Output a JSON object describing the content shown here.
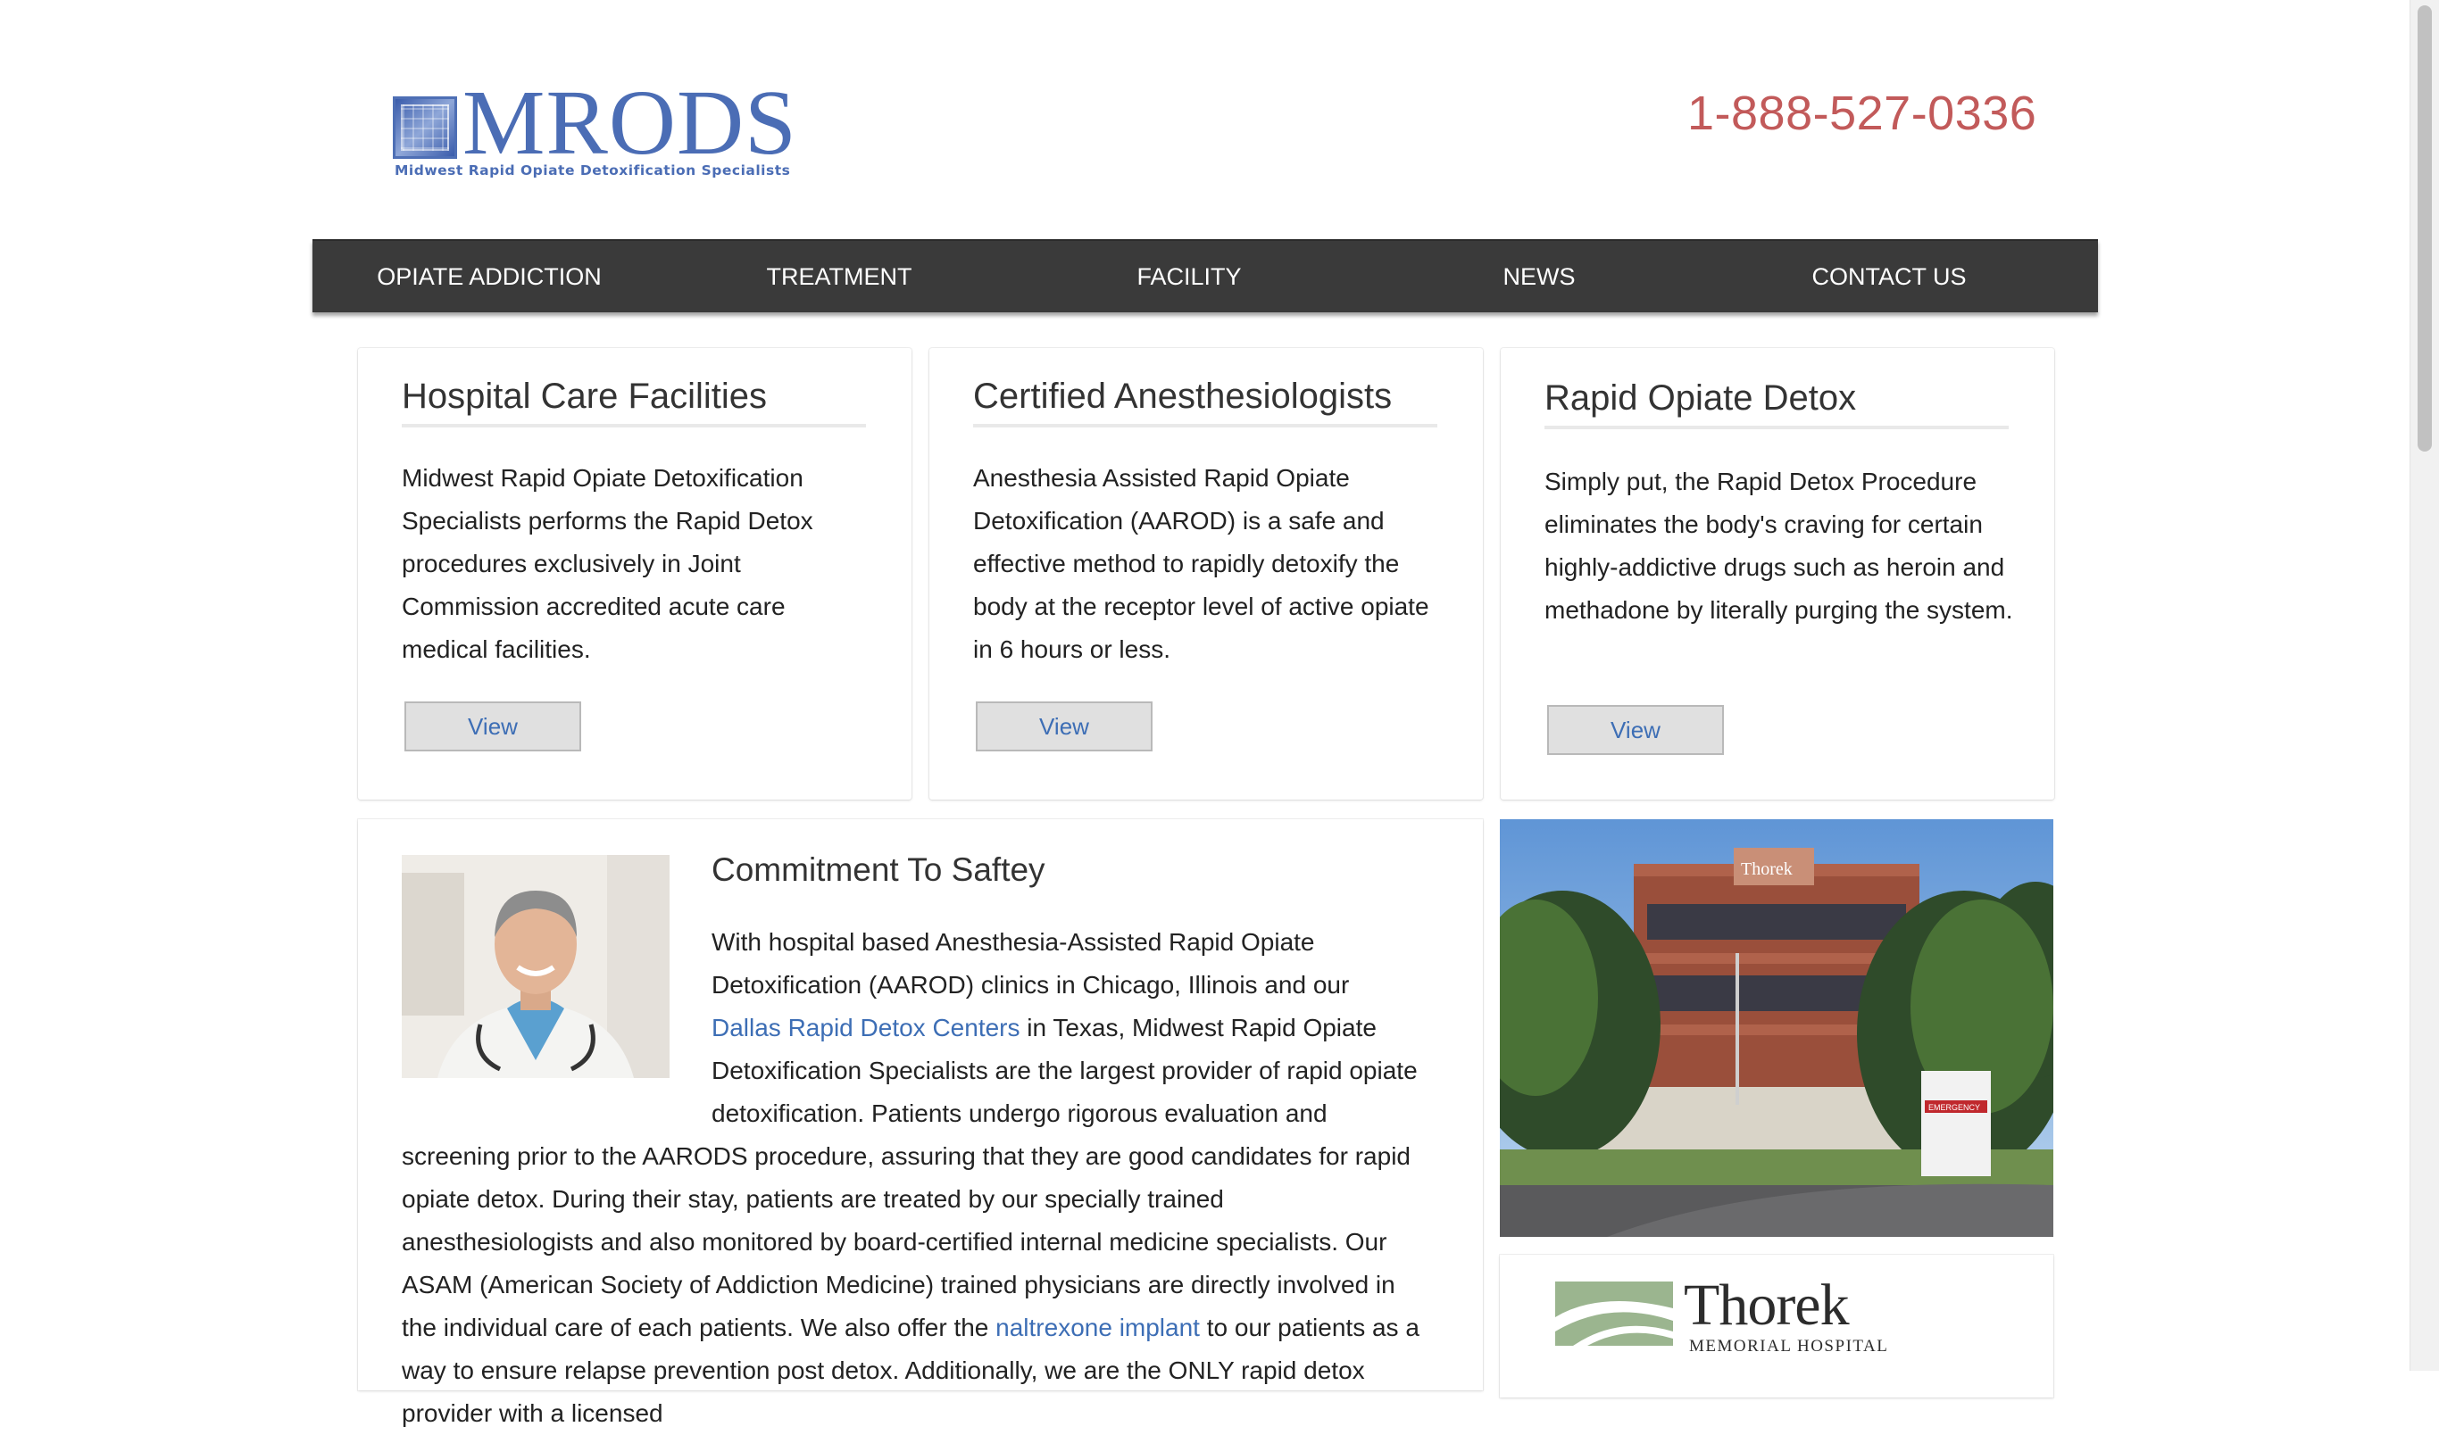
{
  "header": {
    "logo_text": "MRODS",
    "logo_tagline": "Midwest Rapid Opiate Detoxification Specialists",
    "phone": "1-888-527-0336"
  },
  "nav": {
    "items": [
      {
        "label": "OPIATE ADDICTION"
      },
      {
        "label": "TREATMENT"
      },
      {
        "label": "FACILITY"
      },
      {
        "label": "NEWS"
      },
      {
        "label": "CONTACT US"
      }
    ]
  },
  "cards": [
    {
      "title": "Hospital Care Facilities",
      "text": "Midwest Rapid Opiate Detoxification Specialists performs the Rapid Detox procedures exclusively in Joint Commission accredited acute care medical facilities.",
      "button": "View"
    },
    {
      "title": "Certified Anesthesiologists",
      "text": "Anesthesia Assisted Rapid Opiate Detoxification (AAROD) is a safe and effective method to rapidly detoxify the body at the receptor level of active opiate in 6 hours or less.",
      "button": "View"
    },
    {
      "title": "Rapid Opiate Detox",
      "text": "Simply put, the Rapid Detox Procedure eliminates the body's craving for certain highly-addictive drugs such as heroin and methadone by literally purging the system.",
      "button": "View"
    }
  ],
  "commitment": {
    "title": "Commitment To Saftey",
    "text_1": "With hospital based Anesthesia-Assisted Rapid Opiate Detoxification (AAROD) clinics in Chicago, Illinois and our ",
    "link_1": "Dallas Rapid Detox Centers",
    "text_2": " in Texas, Midwest Rapid Opiate Detoxification Specialists are the largest provider of rapid opiate detoxification. Patients undergo rigorous evaluation and screening prior to the AARODS procedure, assuring that they are good candidates for rapid opiate detox. During their stay, patients are treated by our specially trained anesthesiologists and also monitored by board-certified internal medicine specialists. Our ASAM (American Society of Addiction Medicine) trained physicians are directly involved in the individual care of each patients. We also offer the ",
    "link_2": "naltrexone implant",
    "text_3": " to our patients as a way to ensure relapse prevention post detox. Additionally, we are the ONLY rapid detox provider with a licensed"
  },
  "sidebar": {
    "thorek_name": "Thorek",
    "thorek_sub": "MEMORIAL HOSPITAL",
    "building_sign": "Thorek",
    "sign_label": "EMERGENCY"
  },
  "colors": {
    "brand_blue": "#4b6db5",
    "phone_red": "#c25a5a",
    "nav_bg": "#3a3a3a",
    "link": "#3d6eb5"
  }
}
